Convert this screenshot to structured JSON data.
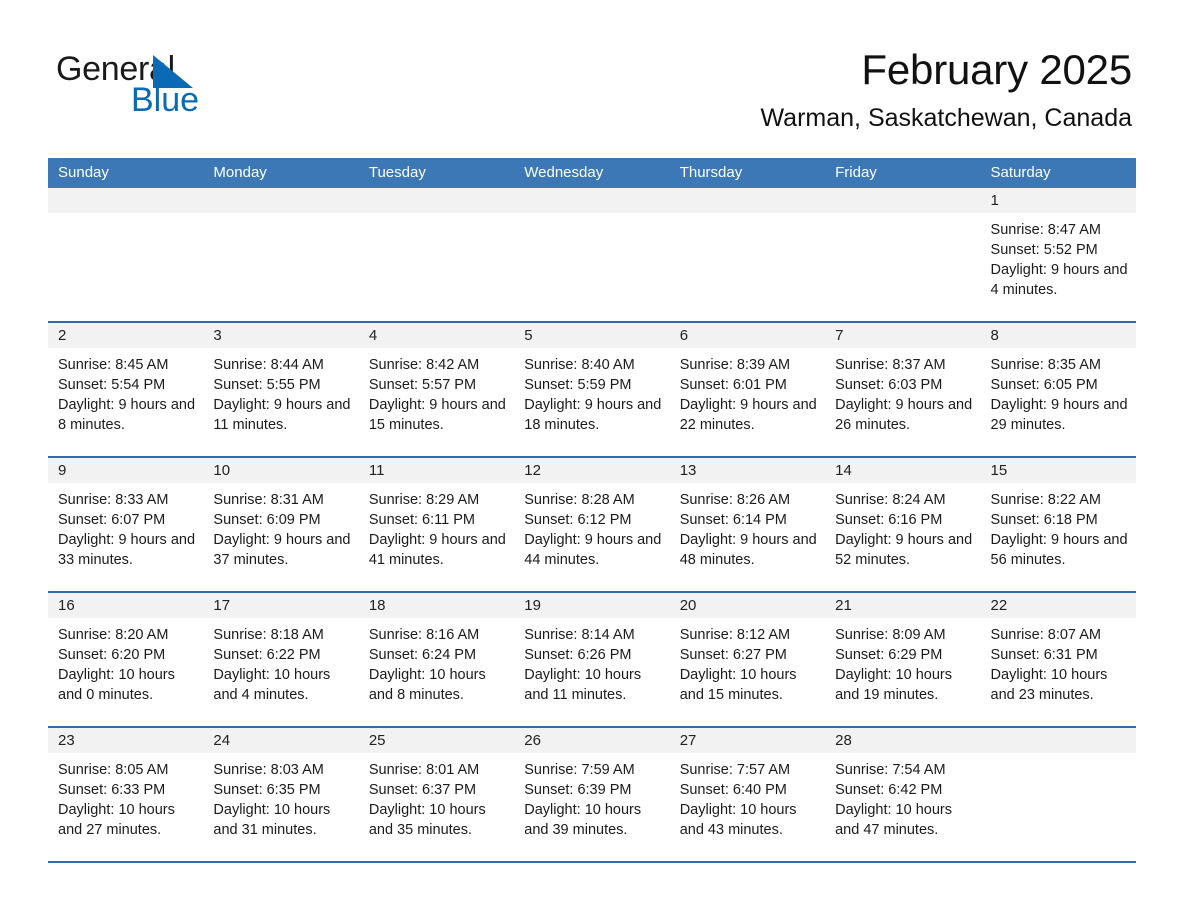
{
  "brand": {
    "name_part1": "General",
    "name_part2": "Blue",
    "accent_color": "#0a6ab5"
  },
  "header": {
    "title": "February 2025",
    "subtitle": "Warman, Saskatchewan, Canada"
  },
  "calendar": {
    "header_bg": "#3b78b5",
    "row_divider": "#2f6ca8",
    "daynum_bg": "#f2f2f2",
    "day_headers": [
      "Sunday",
      "Monday",
      "Tuesday",
      "Wednesday",
      "Thursday",
      "Friday",
      "Saturday"
    ],
    "labels": {
      "sunrise": "Sunrise:",
      "sunset": "Sunset:",
      "daylight": "Daylight:"
    },
    "weeks": [
      [
        {
          "day": "",
          "empty": true
        },
        {
          "day": "",
          "empty": true
        },
        {
          "day": "",
          "empty": true
        },
        {
          "day": "",
          "empty": true
        },
        {
          "day": "",
          "empty": true
        },
        {
          "day": "",
          "empty": true
        },
        {
          "day": "1",
          "sunrise": "Sunrise: 8:47 AM",
          "sunset": "Sunset: 5:52 PM",
          "daylight": "Daylight: 9 hours and 4 minutes."
        }
      ],
      [
        {
          "day": "2",
          "sunrise": "Sunrise: 8:45 AM",
          "sunset": "Sunset: 5:54 PM",
          "daylight": "Daylight: 9 hours and 8 minutes."
        },
        {
          "day": "3",
          "sunrise": "Sunrise: 8:44 AM",
          "sunset": "Sunset: 5:55 PM",
          "daylight": "Daylight: 9 hours and 11 minutes."
        },
        {
          "day": "4",
          "sunrise": "Sunrise: 8:42 AM",
          "sunset": "Sunset: 5:57 PM",
          "daylight": "Daylight: 9 hours and 15 minutes."
        },
        {
          "day": "5",
          "sunrise": "Sunrise: 8:40 AM",
          "sunset": "Sunset: 5:59 PM",
          "daylight": "Daylight: 9 hours and 18 minutes."
        },
        {
          "day": "6",
          "sunrise": "Sunrise: 8:39 AM",
          "sunset": "Sunset: 6:01 PM",
          "daylight": "Daylight: 9 hours and 22 minutes."
        },
        {
          "day": "7",
          "sunrise": "Sunrise: 8:37 AM",
          "sunset": "Sunset: 6:03 PM",
          "daylight": "Daylight: 9 hours and 26 minutes."
        },
        {
          "day": "8",
          "sunrise": "Sunrise: 8:35 AM",
          "sunset": "Sunset: 6:05 PM",
          "daylight": "Daylight: 9 hours and 29 minutes."
        }
      ],
      [
        {
          "day": "9",
          "sunrise": "Sunrise: 8:33 AM",
          "sunset": "Sunset: 6:07 PM",
          "daylight": "Daylight: 9 hours and 33 minutes."
        },
        {
          "day": "10",
          "sunrise": "Sunrise: 8:31 AM",
          "sunset": "Sunset: 6:09 PM",
          "daylight": "Daylight: 9 hours and 37 minutes."
        },
        {
          "day": "11",
          "sunrise": "Sunrise: 8:29 AM",
          "sunset": "Sunset: 6:11 PM",
          "daylight": "Daylight: 9 hours and 41 minutes."
        },
        {
          "day": "12",
          "sunrise": "Sunrise: 8:28 AM",
          "sunset": "Sunset: 6:12 PM",
          "daylight": "Daylight: 9 hours and 44 minutes."
        },
        {
          "day": "13",
          "sunrise": "Sunrise: 8:26 AM",
          "sunset": "Sunset: 6:14 PM",
          "daylight": "Daylight: 9 hours and 48 minutes."
        },
        {
          "day": "14",
          "sunrise": "Sunrise: 8:24 AM",
          "sunset": "Sunset: 6:16 PM",
          "daylight": "Daylight: 9 hours and 52 minutes."
        },
        {
          "day": "15",
          "sunrise": "Sunrise: 8:22 AM",
          "sunset": "Sunset: 6:18 PM",
          "daylight": "Daylight: 9 hours and 56 minutes."
        }
      ],
      [
        {
          "day": "16",
          "sunrise": "Sunrise: 8:20 AM",
          "sunset": "Sunset: 6:20 PM",
          "daylight": "Daylight: 10 hours and 0 minutes."
        },
        {
          "day": "17",
          "sunrise": "Sunrise: 8:18 AM",
          "sunset": "Sunset: 6:22 PM",
          "daylight": "Daylight: 10 hours and 4 minutes."
        },
        {
          "day": "18",
          "sunrise": "Sunrise: 8:16 AM",
          "sunset": "Sunset: 6:24 PM",
          "daylight": "Daylight: 10 hours and 8 minutes."
        },
        {
          "day": "19",
          "sunrise": "Sunrise: 8:14 AM",
          "sunset": "Sunset: 6:26 PM",
          "daylight": "Daylight: 10 hours and 11 minutes."
        },
        {
          "day": "20",
          "sunrise": "Sunrise: 8:12 AM",
          "sunset": "Sunset: 6:27 PM",
          "daylight": "Daylight: 10 hours and 15 minutes."
        },
        {
          "day": "21",
          "sunrise": "Sunrise: 8:09 AM",
          "sunset": "Sunset: 6:29 PM",
          "daylight": "Daylight: 10 hours and 19 minutes."
        },
        {
          "day": "22",
          "sunrise": "Sunrise: 8:07 AM",
          "sunset": "Sunset: 6:31 PM",
          "daylight": "Daylight: 10 hours and 23 minutes."
        }
      ],
      [
        {
          "day": "23",
          "sunrise": "Sunrise: 8:05 AM",
          "sunset": "Sunset: 6:33 PM",
          "daylight": "Daylight: 10 hours and 27 minutes."
        },
        {
          "day": "24",
          "sunrise": "Sunrise: 8:03 AM",
          "sunset": "Sunset: 6:35 PM",
          "daylight": "Daylight: 10 hours and 31 minutes."
        },
        {
          "day": "25",
          "sunrise": "Sunrise: 8:01 AM",
          "sunset": "Sunset: 6:37 PM",
          "daylight": "Daylight: 10 hours and 35 minutes."
        },
        {
          "day": "26",
          "sunrise": "Sunrise: 7:59 AM",
          "sunset": "Sunset: 6:39 PM",
          "daylight": "Daylight: 10 hours and 39 minutes."
        },
        {
          "day": "27",
          "sunrise": "Sunrise: 7:57 AM",
          "sunset": "Sunset: 6:40 PM",
          "daylight": "Daylight: 10 hours and 43 minutes."
        },
        {
          "day": "28",
          "sunrise": "Sunrise: 7:54 AM",
          "sunset": "Sunset: 6:42 PM",
          "daylight": "Daylight: 10 hours and 47 minutes."
        },
        {
          "day": "",
          "empty": true
        }
      ]
    ]
  }
}
